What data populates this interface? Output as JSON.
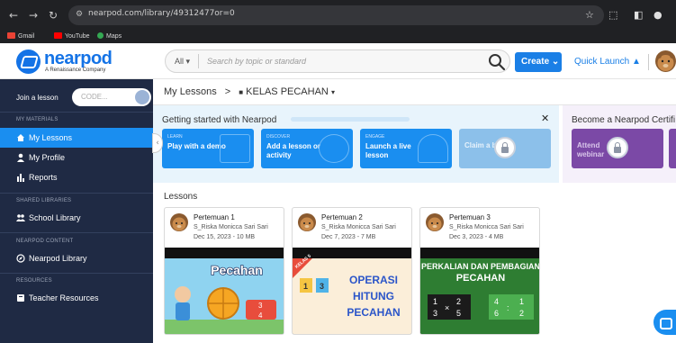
{
  "browser": {
    "url": "nearpod.com/library/49312477or=0",
    "bookmarks": [
      {
        "label": "Gmail",
        "color": "#ea4335"
      },
      {
        "label": "YouTube",
        "color": "#ff0000"
      },
      {
        "label": "Maps",
        "color": "#34a853"
      }
    ]
  },
  "header": {
    "logo_word": "nearpod",
    "logo_sub": "A Renaissance Company",
    "search_scope": "All",
    "search_placeholder": "Search by topic or standard",
    "create_label": "Create",
    "quick_launch_label": "Quick Launch"
  },
  "sidebar": {
    "join_label": "Join a lesson",
    "code_placeholder": "CODE...",
    "sections": {
      "my_materials": "MY MATERIALS",
      "shared": "SHARED LIBRARIES",
      "content": "NEARPOD CONTENT",
      "resources": "RESOURCES"
    },
    "items": {
      "my_lessons": "My Lessons",
      "my_profile": "My Profile",
      "reports": "Reports",
      "school_library": "School Library",
      "nearpod_library": "Nearpod Library",
      "teacher_resources": "Teacher Resources"
    }
  },
  "breadcrumb": {
    "root": "My Lessons",
    "folder": "KELAS PECAHAN"
  },
  "getting_started": {
    "title": "Getting started with Nearpod",
    "progress": 0.0,
    "cards": [
      {
        "tag": "LEARN",
        "name": "Play with a demo"
      },
      {
        "tag": "DISCOVER",
        "name": "Add a lesson or activity"
      },
      {
        "tag": "ENGAGE",
        "name": "Launch a live lesson"
      },
      {
        "tag": "",
        "name": "Claim a badge"
      }
    ]
  },
  "certification": {
    "title": "Become a Nearpod Certifi",
    "card_name": "Attend webinar"
  },
  "lessons": {
    "heading": "Lessons",
    "items": [
      {
        "title": "Pertemuan 1",
        "author": "S_Riska Monicca Sari Sari",
        "date": "Dec 15, 2023 - 10 MB",
        "thumb_title": "Pecahan"
      },
      {
        "title": "Pertemuan 2",
        "author": "S_Riska Monicca Sari Sari",
        "date": "Dec 7, 2023 - 7 MB",
        "thumb_title": "OPERASI HITUNG PECAHAN",
        "thumb_tag": "KELAS 5"
      },
      {
        "title": "Pertemuan 3",
        "author": "S_Riska Monicca Sari Sari",
        "date": "Dec 3, 2023 - 4 MB",
        "thumb_title": "PERKALIAN DAN PEMBAGIAN PECAHAN"
      }
    ]
  },
  "colors": {
    "brand_blue": "#1473e6",
    "sidebar_bg": "#1f2a44",
    "active_item": "#1a8ef0",
    "cert_purple": "#7b49a6"
  }
}
